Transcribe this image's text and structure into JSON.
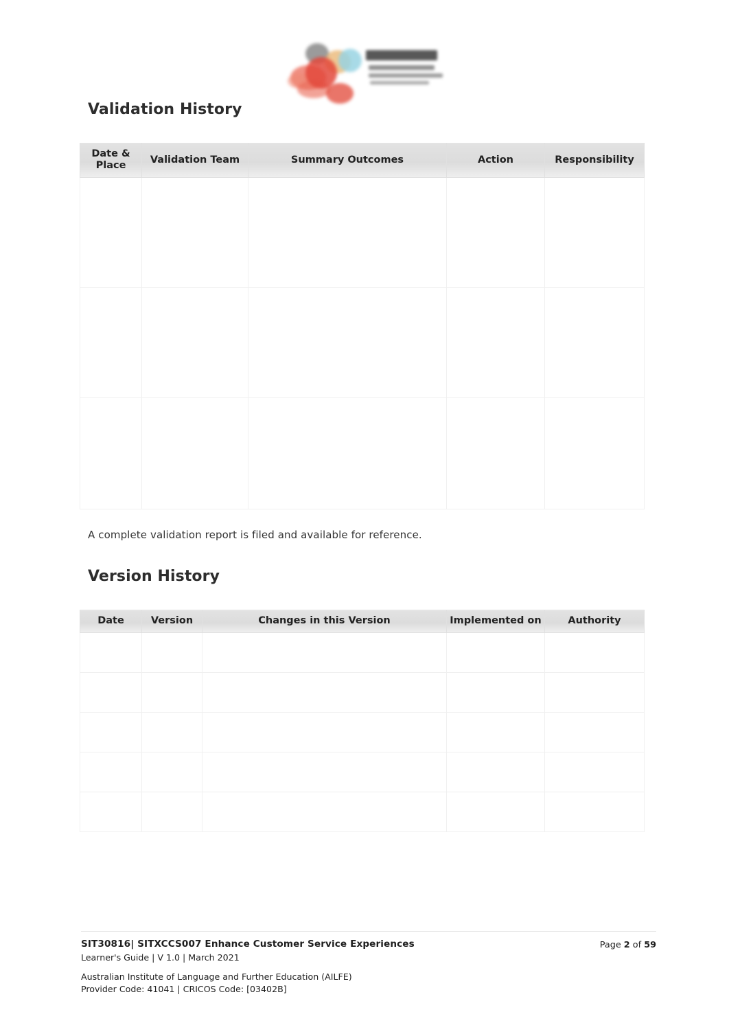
{
  "document": {
    "logo": {
      "name": "ailfe-logo",
      "mark_colors": [
        "#e03a2c",
        "#e8523f",
        "#e8b16a",
        "#8fd0e0",
        "#6d6d6d"
      ],
      "text_color": "#6e6e6e"
    }
  },
  "sections": {
    "validation": {
      "title": "Validation History",
      "note": "A complete validation report is filed and available for reference.",
      "table": {
        "columns": [
          "Date & Place",
          "Validation Team",
          "Summary Outcomes",
          "Action",
          "Responsibility"
        ],
        "rows": [
          [
            "",
            "",
            "",
            "",
            ""
          ],
          [
            "",
            "",
            "",
            "",
            ""
          ],
          [
            "",
            "",
            "",
            "",
            ""
          ]
        ]
      }
    },
    "version": {
      "title": "Version History",
      "table": {
        "columns": [
          "Date",
          "Version",
          "Changes in this Version",
          "Implemented on",
          "Authority"
        ],
        "rows": [
          [
            "",
            "",
            "",
            "",
            ""
          ],
          [
            "",
            "",
            "",
            "",
            ""
          ],
          [
            "",
            "",
            "",
            "",
            ""
          ],
          [
            "",
            "",
            "",
            "",
            ""
          ],
          [
            "",
            "",
            "",
            "",
            ""
          ]
        ]
      }
    }
  },
  "footer": {
    "unit_title": "SIT30816| SITXCCS007 Enhance Customer Service Experiences",
    "guide_line": "Learner's Guide | V 1.0 | March 2021",
    "page_prefix": "Page",
    "page_number": "2",
    "page_of": "of",
    "page_total": "59",
    "org_name": "Australian Institute of Language and Further Education (AILFE)",
    "org_codes": "Provider Code: 41041 | CRICOS Code: [03402B]"
  }
}
